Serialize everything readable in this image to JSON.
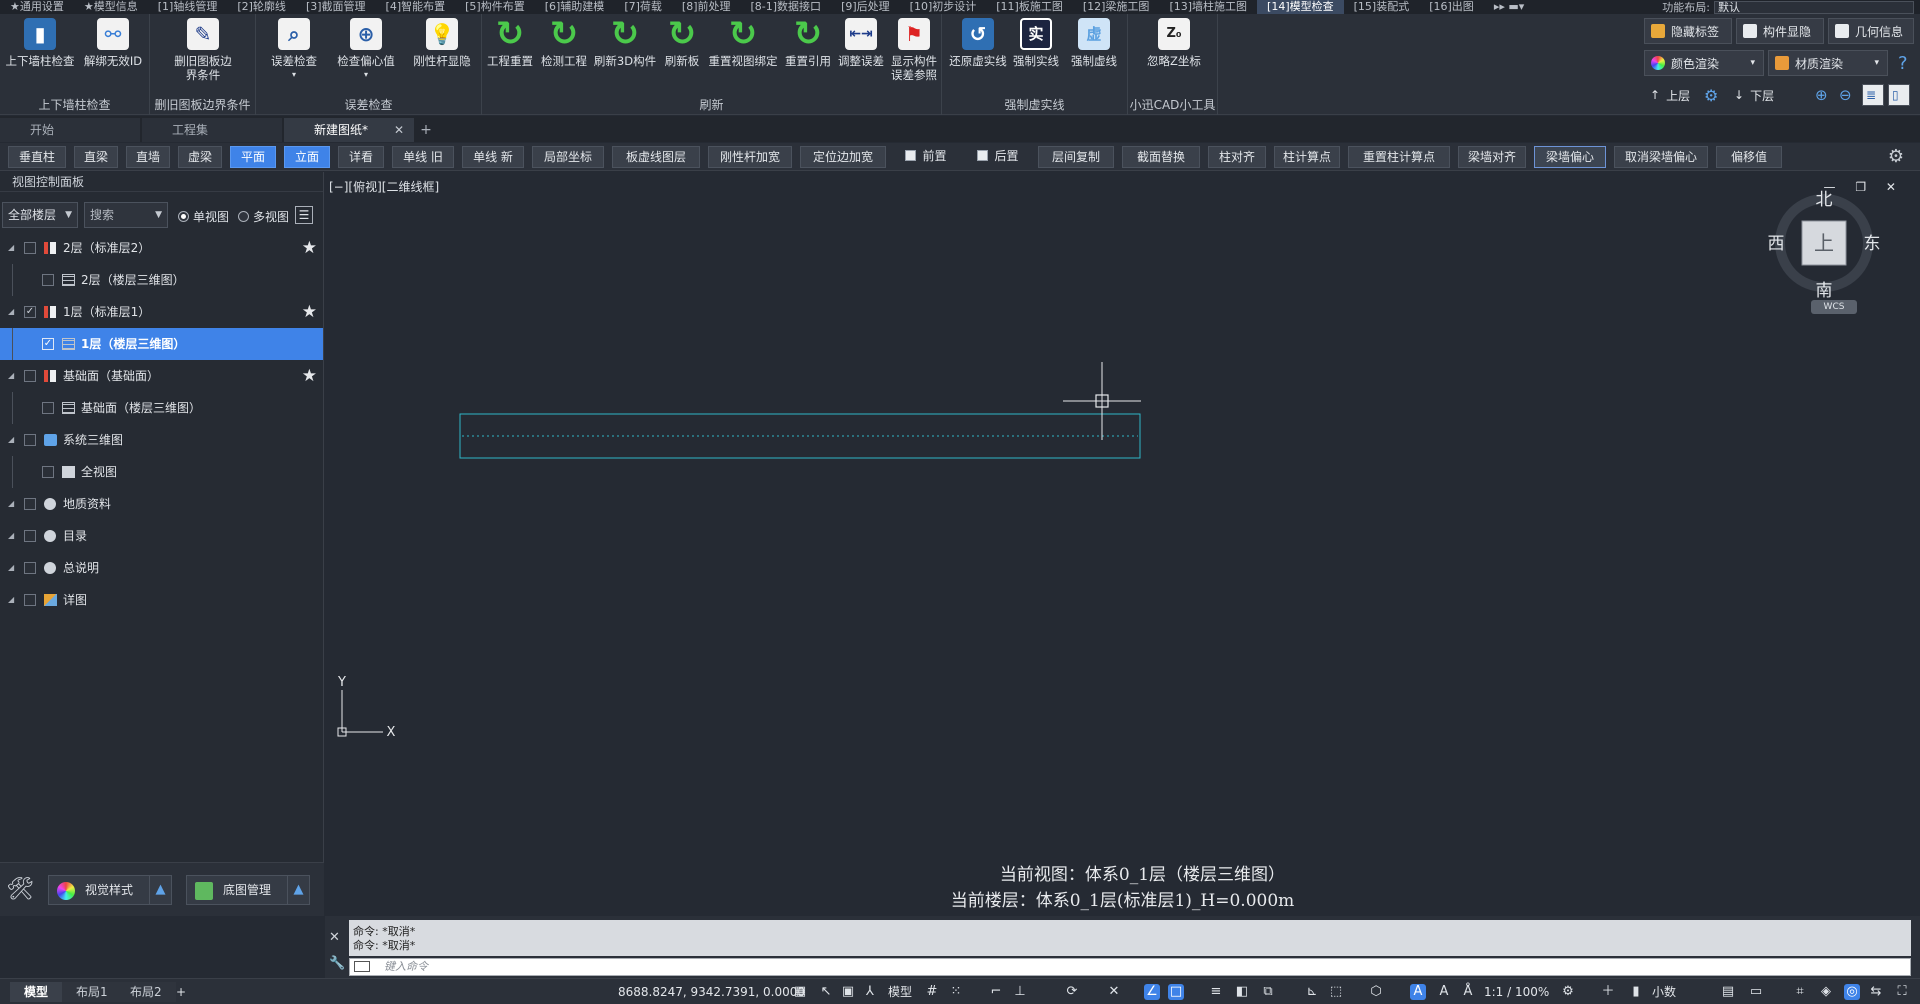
{
  "menubar": {
    "items": [
      "★通用设置",
      "★模型信息",
      "[1]轴线管理",
      "[2]轮廓线",
      "[3]截面管理",
      "[4]智能布置",
      "[5]构件布置",
      "[6]辅助建模",
      "[7]荷载",
      "[8]前处理",
      "[8-1]数据接口",
      "[9]后处理",
      "[10]初步设计",
      "[11]板施工图",
      "[12]梁施工图",
      "[13]墙柱施工图",
      "[14]模型检查",
      "[15]装配式",
      "[16]出图"
    ],
    "active_index": 16,
    "layout_label": "功能布局:",
    "layout_value": "默认"
  },
  "ribbon": {
    "groups": [
      {
        "title": "上下墙柱检查",
        "buttons": [
          "上下墙柱检查",
          "解绑无效ID"
        ]
      },
      {
        "title": "删旧图板边界条件",
        "buttons": [
          "删旧图板边界条件"
        ]
      },
      {
        "title": "误差检查",
        "buttons": [
          "误差检查",
          "检查偏心值",
          "刚性杆显隐"
        ]
      },
      {
        "title": "刷新",
        "buttons": [
          "工程重置",
          "检测工程",
          "刷新3D构件",
          "刷新板",
          "重置视图绑定",
          "重置引用",
          "调整误差",
          "显示构件误差参照"
        ]
      },
      {
        "title": "强制虚实线",
        "buttons": [
          "还原虚实线",
          "强制实线",
          "强制虚线"
        ]
      },
      {
        "title": "小迅CAD小工具",
        "buttons": [
          "忽略Z坐标"
        ]
      }
    ],
    "right": {
      "hide_tags": "隐藏标签",
      "component_show": "构件显隐",
      "geometry_info": "几何信息",
      "color_render": "颜色渲染",
      "material_render": "材质渲染",
      "up_floor": "上层",
      "down_floor": "下层",
      "help": "?"
    }
  },
  "doctabs": {
    "tabs": [
      "开始",
      "工程集",
      "新建图纸*"
    ],
    "active_index": 2,
    "add": "+"
  },
  "cmdbar": {
    "buttons": [
      "垂直柱",
      "直梁",
      "直墙",
      "虚梁",
      "平面",
      "立面",
      "详看",
      "单线 旧",
      "单线 新",
      "局部坐标",
      "板虚线图层",
      "刚性杆加宽",
      "定位边加宽",
      "前置",
      "后置",
      "层间复制",
      "截面替换",
      "柱对齐",
      "柱计算点",
      "重置柱计算点",
      "梁墙对齐",
      "梁墙偏心",
      "取消梁墙偏心",
      "偏移值"
    ],
    "selected": [
      "平面",
      "立面"
    ]
  },
  "left_panel": {
    "title": "视图控制面板",
    "floor_filter": "全部楼层",
    "search_placeholder": "搜索",
    "single_view": "单视图",
    "multi_view": "多视图",
    "tree": [
      {
        "label": "2层（标准层2）",
        "level": 0,
        "icon": "floor",
        "checked": false,
        "star": true
      },
      {
        "label": "2层（楼层三维图）",
        "level": 1,
        "icon": "grid",
        "checked": false,
        "star": false
      },
      {
        "label": "1层（标准层1）",
        "level": 0,
        "icon": "floor",
        "checked": true,
        "star": true
      },
      {
        "label": "1层（楼层三维图）",
        "level": 1,
        "icon": "grid",
        "checked": true,
        "star": false,
        "selected": true
      },
      {
        "label": "基础面（基础面）",
        "level": 0,
        "icon": "floor",
        "checked": false,
        "star": true
      },
      {
        "label": "基础面（楼层三维图）",
        "level": 1,
        "icon": "grid",
        "checked": false,
        "star": false
      },
      {
        "label": "系统三维图",
        "level": 0,
        "icon": "sys",
        "checked": false,
        "star": false
      },
      {
        "label": "全视图",
        "level": 1,
        "icon": "full",
        "checked": false,
        "star": false
      },
      {
        "label": "地质资料",
        "level": 0,
        "icon": "ball",
        "checked": false,
        "star": false
      },
      {
        "label": "目录",
        "level": 0,
        "icon": "ball",
        "checked": false,
        "star": false
      },
      {
        "label": "总说明",
        "level": 0,
        "icon": "ball",
        "checked": false,
        "star": false
      },
      {
        "label": "详图",
        "level": 0,
        "icon": "detail",
        "checked": false,
        "star": false
      }
    ],
    "visual_style": "视觉样式",
    "base_map": "底图管理"
  },
  "viewport": {
    "label": "[−][俯视][二维线框]",
    "window_controls": "— ❐ ✕",
    "compass": {
      "north": "北",
      "south": "南",
      "east": "东",
      "west": "西",
      "top": "上",
      "wcs": "WCS"
    },
    "axis_y": "Y",
    "axis_x": "X",
    "current_view": "当前视图：体系0_1层（楼层三维图）",
    "current_floor": "当前楼层：体系0_1层(标准层1)_H=0.000m"
  },
  "command": {
    "history": [
      "命令: *取消*",
      "命令: *取消*"
    ],
    "placeholder": "键入命令"
  },
  "statusbar": {
    "layout_tabs": [
      "模型",
      "布局1",
      "布局2"
    ],
    "active_tab": 0,
    "add": "+",
    "coords": "8688.8247, 9342.7391, 0.0000",
    "model_label": "模型",
    "scale": "1:1 / 100%",
    "units": "小数"
  },
  "colors": {
    "accent": "#3f83e8",
    "canvas": "#252a33",
    "rect_stroke": "#2fb7c7"
  }
}
